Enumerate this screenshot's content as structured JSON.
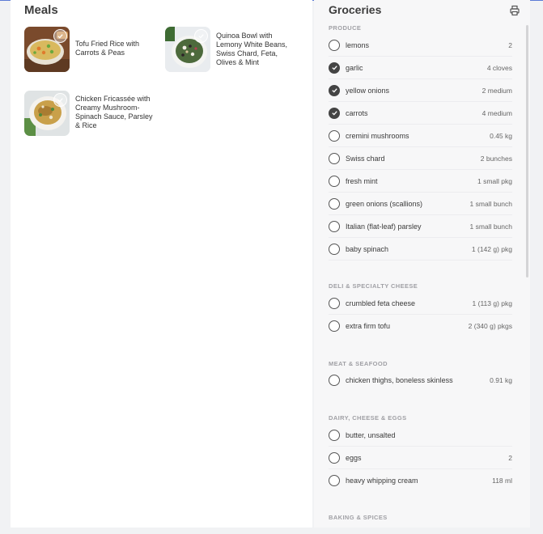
{
  "meals": {
    "title": "Meals",
    "items": [
      {
        "name": "Tofu Fried Rice with Carrots & Peas"
      },
      {
        "name": "Quinoa Bowl with Lemony White Beans, Swiss Chard, Feta, Olives & Mint"
      },
      {
        "name": "Chicken Fricassée with Creamy Mushroom-Spinach Sauce, Parsley & Rice"
      }
    ]
  },
  "groceries": {
    "title": "Groceries",
    "print_icon": "printer-icon",
    "sections": [
      {
        "label": "PRODUCE",
        "items": [
          {
            "name": "lemons",
            "qty": "2",
            "checked": false
          },
          {
            "name": "garlic",
            "qty": "4 cloves",
            "checked": true
          },
          {
            "name": "yellow onions",
            "qty": "2 medium",
            "checked": true
          },
          {
            "name": "carrots",
            "qty": "4 medium",
            "checked": true
          },
          {
            "name": "cremini mushrooms",
            "qty": "0.45 kg",
            "checked": false
          },
          {
            "name": "Swiss chard",
            "qty": "2 bunches",
            "checked": false
          },
          {
            "name": "fresh mint",
            "qty": "1 small pkg",
            "checked": false
          },
          {
            "name": "green onions (scallions)",
            "qty": "1 small bunch",
            "checked": false
          },
          {
            "name": "Italian (flat-leaf) parsley",
            "qty": "1 small bunch",
            "checked": false
          },
          {
            "name": "baby spinach",
            "qty": "1 (142 g) pkg",
            "checked": false
          }
        ]
      },
      {
        "label": "DELI & SPECIALTY CHEESE",
        "items": [
          {
            "name": "crumbled feta cheese",
            "qty": "1 (113 g) pkg",
            "checked": false
          },
          {
            "name": "extra firm tofu",
            "qty": "2 (340 g) pkgs",
            "checked": false
          }
        ]
      },
      {
        "label": "MEAT & SEAFOOD",
        "items": [
          {
            "name": "chicken thighs, boneless skinless",
            "qty": "0.91 kg",
            "checked": false
          }
        ]
      },
      {
        "label": "DAIRY, CHEESE & EGGS",
        "items": [
          {
            "name": "butter, unsalted",
            "qty": "",
            "checked": false
          },
          {
            "name": "eggs",
            "qty": "2",
            "checked": false
          },
          {
            "name": "heavy whipping cream",
            "qty": "118 ml",
            "checked": false
          }
        ]
      },
      {
        "label": "BAKING & SPICES",
        "items": []
      }
    ]
  }
}
